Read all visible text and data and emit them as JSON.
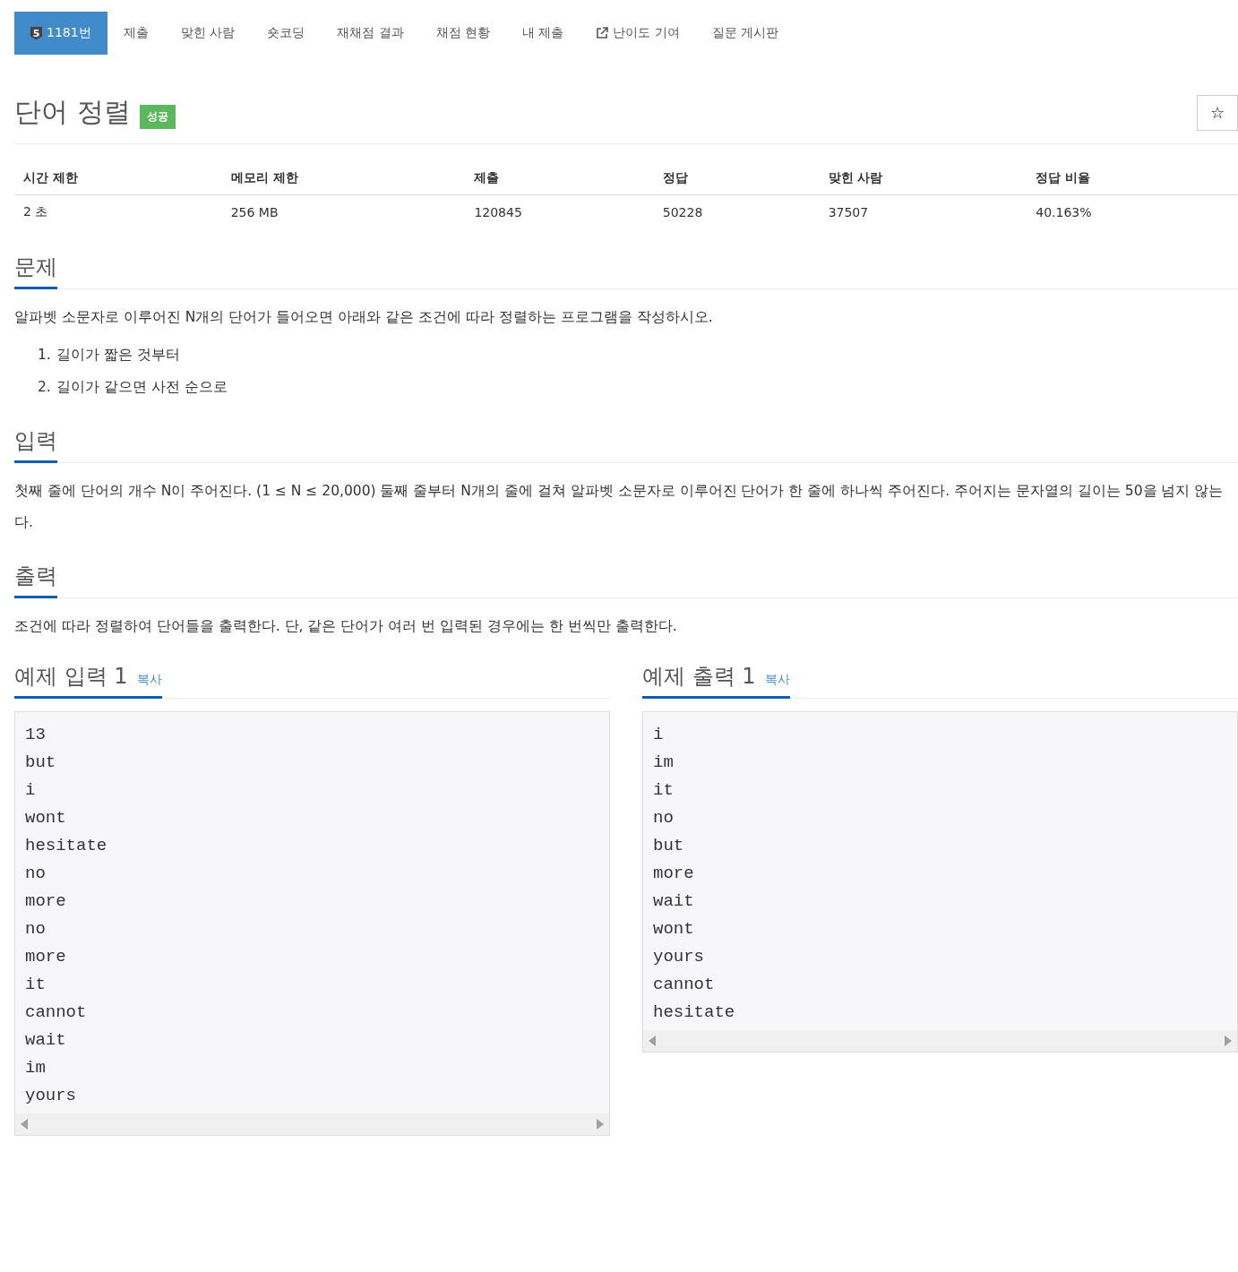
{
  "tabs": [
    {
      "label": "1181번",
      "tier": "5",
      "kind": "problem",
      "selected": true
    },
    {
      "label": "제출",
      "kind": "plain",
      "selected": false
    },
    {
      "label": "맞힌 사람",
      "kind": "plain",
      "selected": false
    },
    {
      "label": "숏코딩",
      "kind": "plain",
      "selected": false
    },
    {
      "label": "재채점 결과",
      "kind": "plain",
      "selected": false
    },
    {
      "label": "채점 현황",
      "kind": "plain",
      "selected": false
    },
    {
      "label": "내 제출",
      "kind": "plain",
      "selected": false
    },
    {
      "label": "난이도 기여",
      "kind": "external",
      "selected": false
    },
    {
      "label": "질문 게시판",
      "kind": "plain",
      "selected": false
    }
  ],
  "title": "단어 정렬",
  "status_badge": "성공",
  "star_button": "☆",
  "info_table": {
    "columns": [
      "시간 제한",
      "메모리 제한",
      "제출",
      "정답",
      "맞힌 사람",
      "정답 비율"
    ],
    "rows": [
      [
        "2 초",
        "256 MB",
        "120845",
        "50228",
        "37507",
        "40.163%"
      ]
    ]
  },
  "sections": [
    {
      "heading": "문제",
      "paragraphs": [
        "알파벳 소문자로 이루어진 N개의 단어가 들어오면 아래와 같은 조건에 따라 정렬하는 프로그램을 작성하시오."
      ],
      "list": [
        {
          "marker": "1.",
          "text": "길이가 짧은 것부터"
        },
        {
          "marker": "2.",
          "text": "길이가 같으면 사전 순으로"
        }
      ]
    },
    {
      "heading": "입력",
      "paragraphs": [
        "첫째 줄에 단어의 개수 N이 주어진다. (1 ≤ N ≤ 20,000) 둘째 줄부터 N개의 줄에 걸쳐 알파벳 소문자로 이루어진 단어가 한 줄에 하나씩 주어진다. 주어지는 문자열의 길이는 50을 넘지 않는다."
      ]
    },
    {
      "heading": "출력",
      "paragraphs": [
        "조건에 따라 정렬하여 단어들을 출력한다. 단, 같은 단어가 여러 번 입력된 경우에는 한 번씩만 출력한다."
      ]
    }
  ],
  "samples": [
    {
      "heading": "예제 입력 1",
      "copy": "복사",
      "lines": [
        "13",
        "but",
        "i",
        "wont",
        "hesitate",
        "no",
        "more",
        "no",
        "more",
        "it",
        "cannot",
        "wait",
        "im",
        "yours"
      ]
    },
    {
      "heading": "예제 출력 1",
      "copy": "복사",
      "lines": [
        "i",
        "im",
        "it",
        "no",
        "but",
        "more",
        "wait",
        "wont",
        "yours",
        "cannot",
        "hesitate"
      ]
    }
  ]
}
